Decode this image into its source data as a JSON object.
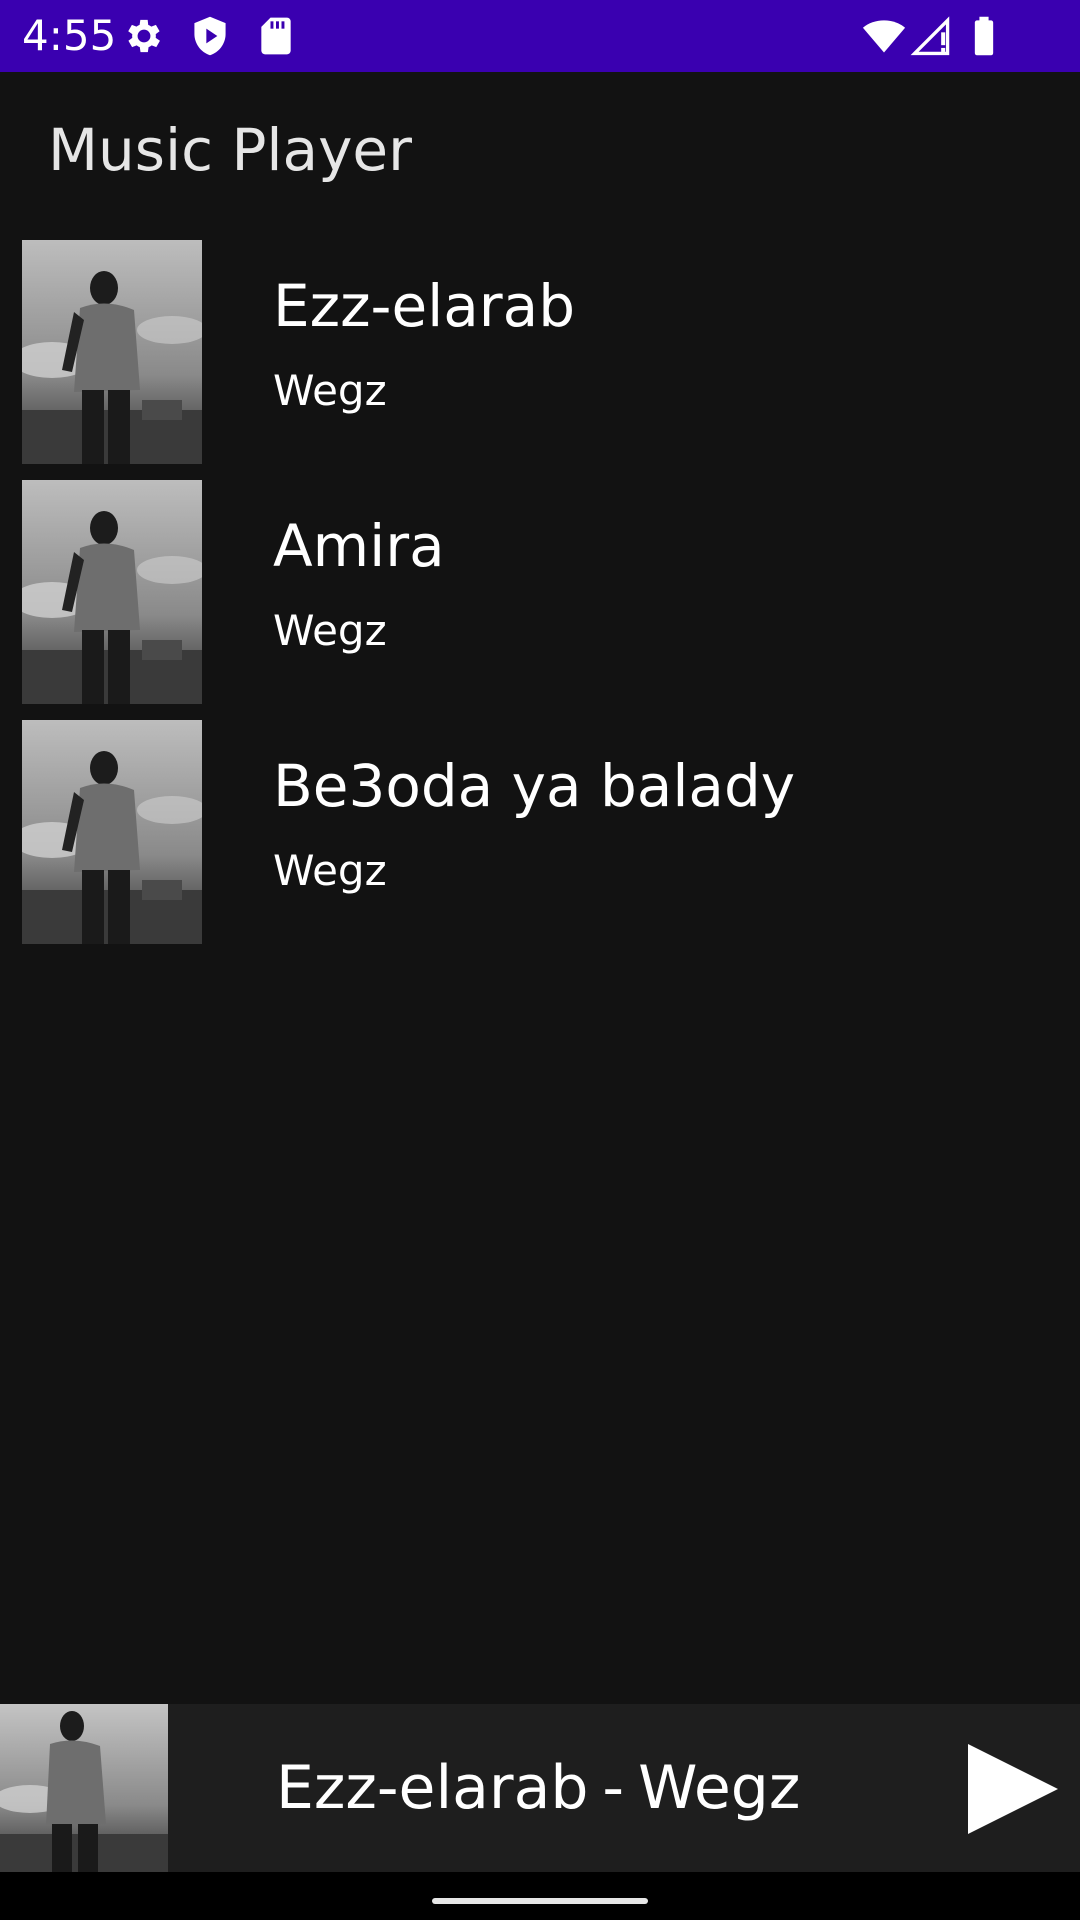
{
  "status_bar": {
    "time": "4:55",
    "background": "#3a00b0",
    "icons_left": [
      "settings-icon",
      "shield-play-icon",
      "sd-card-icon"
    ],
    "icons_right": [
      "wifi-icon",
      "signal-icon",
      "battery-icon"
    ]
  },
  "app": {
    "title": "Music Player"
  },
  "songs": [
    {
      "title": "Ezz-elarab",
      "artist": "Wegz",
      "cover": "album-cover-image"
    },
    {
      "title": "Amira",
      "artist": "Wegz",
      "cover": "album-cover-image"
    },
    {
      "title": "Be3oda ya balady",
      "artist": "Wegz",
      "cover": "album-cover-image"
    }
  ],
  "now_playing": {
    "title": "Ezz-elarab",
    "separator": "-",
    "artist": "Wegz",
    "action": "play-icon"
  },
  "colors": {
    "background": "#121212",
    "now_playing_background": "#1e1e1e",
    "text": "#ffffff"
  }
}
